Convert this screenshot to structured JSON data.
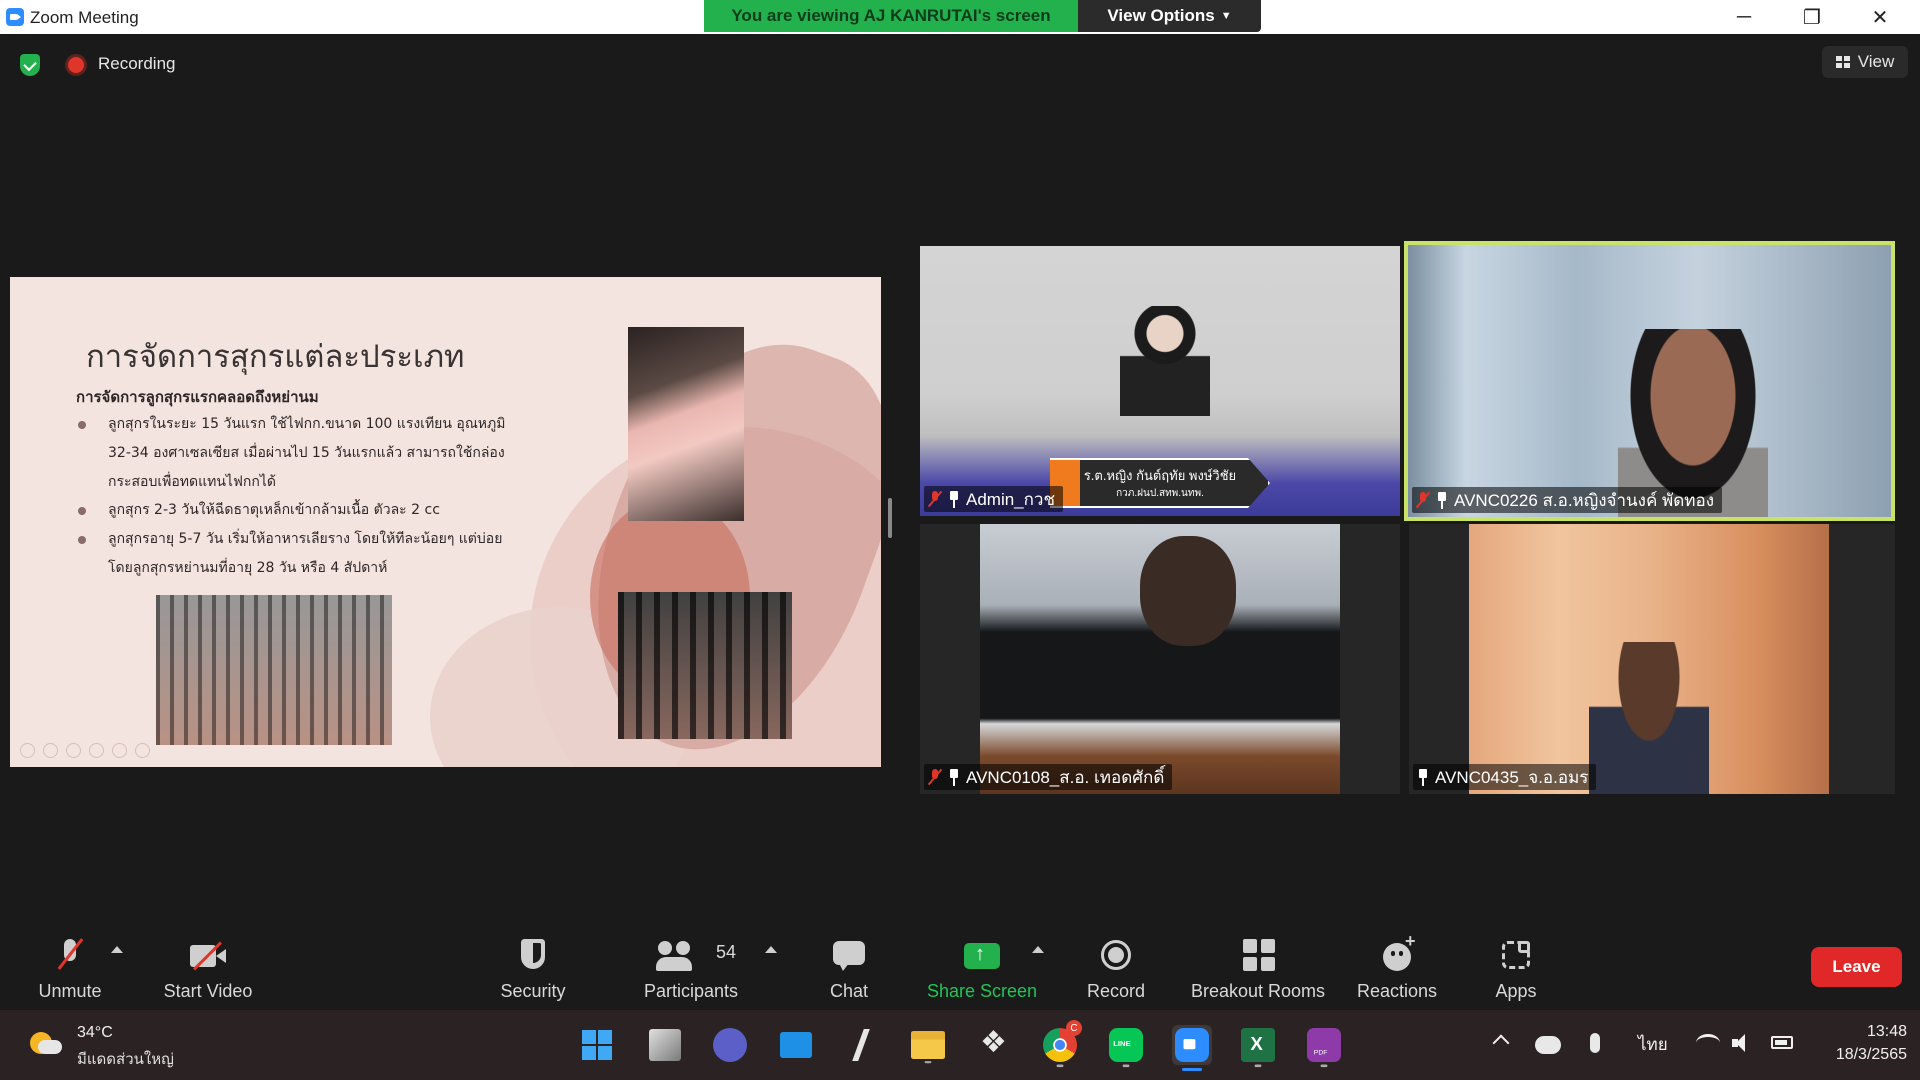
{
  "window": {
    "title": "Zoom Meeting",
    "viewing_banner": "You are viewing AJ KANRUTAI's screen",
    "view_options_label": "View Options",
    "minimize": "─",
    "restore": "❐",
    "close": "✕"
  },
  "meeting_bar": {
    "recording_label": "Recording",
    "view_label": "View"
  },
  "slide": {
    "title": "การจัดการสุกรแต่ละประเภท",
    "subtitle": "การจัดการลูกสุกรแรกคลอดถึงหย่านม",
    "bullets": [
      "ลูกสุกรในระยะ 15 วันแรก ใช้ไฟกก.ขนาด 100 แรงเทียน อุณหภูมิ 32-34 องศาเซลเซียส เมื่อผ่านไป 15 วันแรกแล้ว สามารถใช้กล่องกระสอบเพื่อทดแทนไฟกกได้",
      "ลูกสุกร 2-3 วันให้ฉีดธาตุเหล็กเข้ากล้ามเนื้อ ตัวละ 2 cc",
      "ลูกสุกรอายุ 5-7 วัน เริ่มให้อาหารเลียราง โดยให้ทีละน้อยๆ แต่บ่อย โดยลูกสุกรหย่านมที่อายุ 28 วัน หรือ 4 สัปดาห์"
    ]
  },
  "participants_tiles": [
    {
      "name": "Admin_กวช",
      "muted": true,
      "placard_line1": "ร.ต.หญิง กันต์ฤทัย  พงษ์วิชัย",
      "placard_line2": "กวภ.ฝนป.สทพ.นทพ."
    },
    {
      "name": "AVNC0226 ส.อ.หญิงจำนงค์ พัดทอง",
      "muted": true
    },
    {
      "name": "AVNC0108_ส.อ. เทอดศักดิ์",
      "muted": true
    },
    {
      "name": "AVNC0435_จ.อ.อมร",
      "muted": false
    }
  ],
  "controls": {
    "unmute": "Unmute",
    "start_video": "Start Video",
    "security": "Security",
    "participants": "Participants",
    "participants_count": "54",
    "chat": "Chat",
    "share_screen": "Share Screen",
    "record": "Record",
    "breakout_rooms": "Breakout Rooms",
    "reactions": "Reactions",
    "apps": "Apps",
    "leave": "Leave"
  },
  "taskbar": {
    "weather_temp": "34°C",
    "weather_desc": "มีแดดส่วนใหญ่",
    "chrome_badge": "C",
    "language": "ไทย",
    "time": "13:48",
    "date": "18/3/2565"
  },
  "colors": {
    "banner_green": "#23b14d",
    "leave_red": "#e02828",
    "active_speaker_border": "#c9e36a",
    "zoom_blue": "#2d8cff"
  }
}
